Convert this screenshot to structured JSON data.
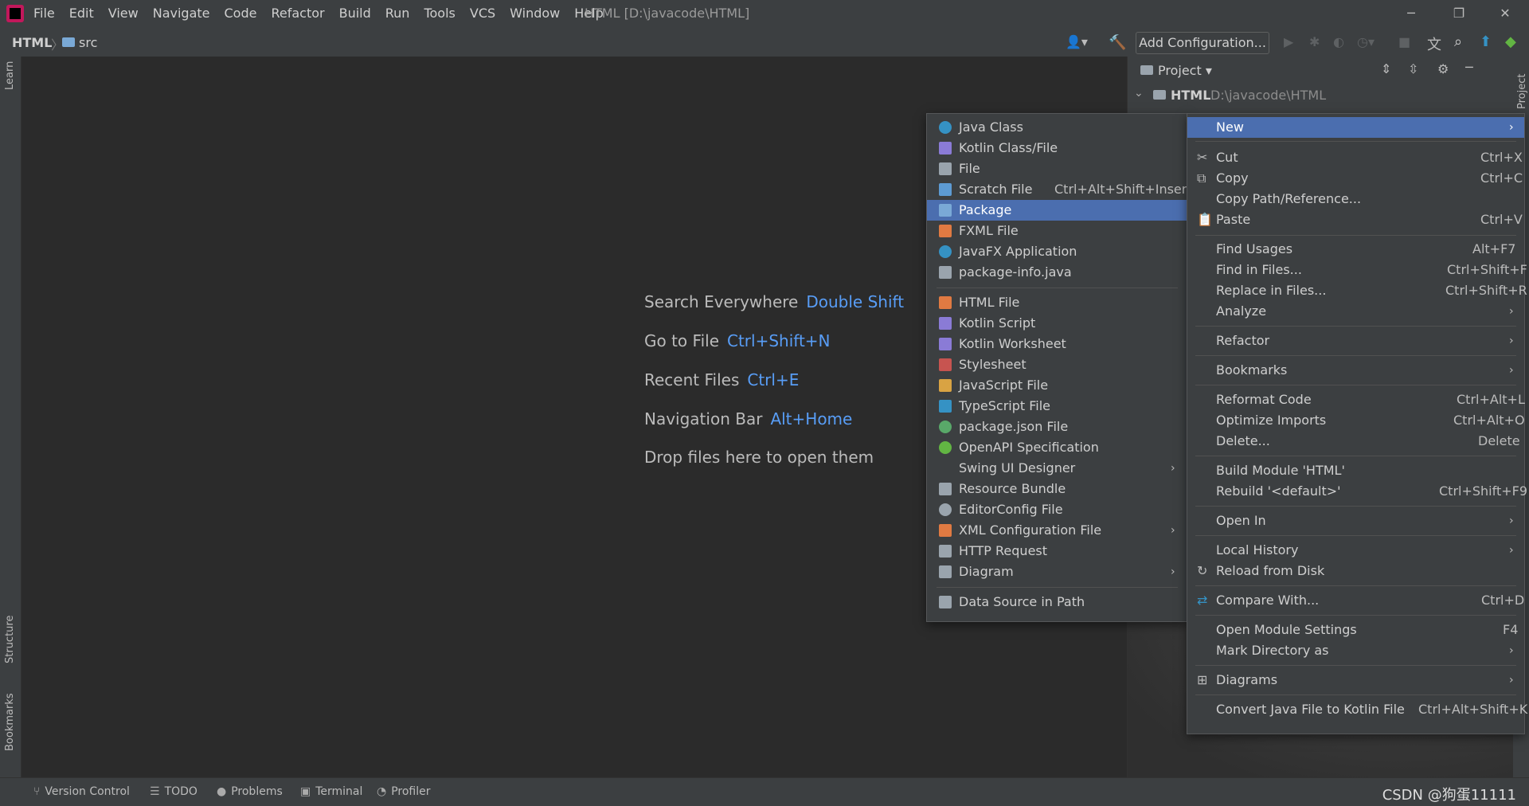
{
  "window": {
    "title": "HTML [D:\\javacode\\HTML]",
    "menus": [
      "File",
      "Edit",
      "View",
      "Navigate",
      "Code",
      "Refactor",
      "Build",
      "Run",
      "Tools",
      "VCS",
      "Window",
      "Help"
    ],
    "controls": {
      "minimize": "─",
      "restore": "❐",
      "close": "✕"
    }
  },
  "navbar": {
    "project": "HTML",
    "folder": "src",
    "add_configuration": "Add Configuration..."
  },
  "left_strip": {
    "learn": "Learn",
    "structure": "Structure",
    "bookmarks": "Bookmarks"
  },
  "right_strip": {
    "project": "Project"
  },
  "editor_hints": [
    {
      "label": "Search Everywhere",
      "key": "Double Shift"
    },
    {
      "label": "Go to File",
      "key": "Ctrl+Shift+N"
    },
    {
      "label": "Recent Files",
      "key": "Ctrl+E"
    },
    {
      "label": "Navigation Bar",
      "key": "Alt+Home"
    },
    {
      "label": "Drop files here to open them",
      "key": ""
    }
  ],
  "project_panel": {
    "title": "Project",
    "root_name": "HTML",
    "root_path": "D:\\javacode\\HTML"
  },
  "context_menu": {
    "items": [
      {
        "label": "New",
        "shortcut": "",
        "submenu": true,
        "selected": true
      },
      {
        "label": "Cut",
        "shortcut": "Ctrl+X",
        "icon": "cut-icon"
      },
      {
        "label": "Copy",
        "shortcut": "Ctrl+C",
        "icon": "copy-icon"
      },
      {
        "label": "Copy Path/Reference...",
        "shortcut": ""
      },
      {
        "label": "Paste",
        "shortcut": "Ctrl+V",
        "icon": "paste-icon"
      },
      {
        "label": "Find Usages",
        "shortcut": "Alt+F7"
      },
      {
        "label": "Find in Files...",
        "shortcut": "Ctrl+Shift+F"
      },
      {
        "label": "Replace in Files...",
        "shortcut": "Ctrl+Shift+R"
      },
      {
        "label": "Analyze",
        "shortcut": "",
        "submenu": true
      },
      {
        "label": "Refactor",
        "shortcut": "",
        "submenu": true
      },
      {
        "label": "Bookmarks",
        "shortcut": "",
        "submenu": true
      },
      {
        "label": "Reformat Code",
        "shortcut": "Ctrl+Alt+L"
      },
      {
        "label": "Optimize Imports",
        "shortcut": "Ctrl+Alt+O"
      },
      {
        "label": "Delete...",
        "shortcut": "Delete"
      },
      {
        "label": "Build Module 'HTML'",
        "shortcut": ""
      },
      {
        "label": "Rebuild '<default>'",
        "shortcut": "Ctrl+Shift+F9"
      },
      {
        "label": "Open In",
        "shortcut": "",
        "submenu": true
      },
      {
        "label": "Local History",
        "shortcut": "",
        "submenu": true
      },
      {
        "label": "Reload from Disk",
        "shortcut": "",
        "icon": "reload-icon"
      },
      {
        "label": "Compare With...",
        "shortcut": "Ctrl+D",
        "icon": "compare-icon"
      },
      {
        "label": "Open Module Settings",
        "shortcut": "F4"
      },
      {
        "label": "Mark Directory as",
        "shortcut": "",
        "submenu": true
      },
      {
        "label": "Diagrams",
        "shortcut": "",
        "submenu": true,
        "icon": "diagrams-icon"
      },
      {
        "label": "Convert Java File to Kotlin File",
        "shortcut": "Ctrl+Alt+Shift+K"
      }
    ]
  },
  "new_submenu": {
    "items": [
      {
        "label": "Java Class",
        "shortcut": "",
        "icon": "java-class-icon",
        "color": "#3592c4"
      },
      {
        "label": "Kotlin Class/File",
        "shortcut": "",
        "icon": "kotlin-file-icon",
        "color": "#8a7bd6"
      },
      {
        "label": "File",
        "shortcut": "",
        "icon": "file-icon",
        "color": "#9aa4ad"
      },
      {
        "label": "Scratch File",
        "shortcut": "Ctrl+Alt+Shift+Insert",
        "icon": "scratch-file-icon",
        "color": "#5d9bd3"
      },
      {
        "label": "Package",
        "shortcut": "",
        "icon": "package-icon",
        "color": "#7aa9d6",
        "selected": true
      },
      {
        "label": "FXML File",
        "shortcut": "",
        "icon": "fxml-file-icon",
        "color": "#e07a42"
      },
      {
        "label": "JavaFX Application",
        "shortcut": "",
        "icon": "javafx-icon",
        "color": "#3592c4"
      },
      {
        "label": "package-info.java",
        "shortcut": "",
        "icon": "package-info-icon",
        "color": "#9aa4ad"
      },
      {
        "label": "HTML File",
        "shortcut": "",
        "icon": "html-file-icon",
        "color": "#e07a42"
      },
      {
        "label": "Kotlin Script",
        "shortcut": "",
        "icon": "kotlin-script-icon",
        "color": "#8a7bd6"
      },
      {
        "label": "Kotlin Worksheet",
        "shortcut": "",
        "icon": "kotlin-worksheet-icon",
        "color": "#8a7bd6"
      },
      {
        "label": "Stylesheet",
        "shortcut": "",
        "icon": "css-icon",
        "color": "#c75450"
      },
      {
        "label": "JavaScript File",
        "shortcut": "",
        "icon": "js-file-icon",
        "color": "#d9a343"
      },
      {
        "label": "TypeScript File",
        "shortcut": "",
        "icon": "ts-file-icon",
        "color": "#3592c4"
      },
      {
        "label": "package.json File",
        "shortcut": "",
        "icon": "npm-icon",
        "color": "#59a869"
      },
      {
        "label": "OpenAPI Specification",
        "shortcut": "",
        "icon": "openapi-icon",
        "color": "#62b543"
      },
      {
        "label": "Swing UI Designer",
        "shortcut": "",
        "submenu": true
      },
      {
        "label": "Resource Bundle",
        "shortcut": "",
        "icon": "resource-bundle-icon",
        "color": "#9aa4ad"
      },
      {
        "label": "EditorConfig File",
        "shortcut": "",
        "icon": "gear-icon",
        "color": "#9aa4ad"
      },
      {
        "label": "XML Configuration File",
        "shortcut": "",
        "submenu": true,
        "icon": "xml-file-icon",
        "color": "#e07a42"
      },
      {
        "label": "HTTP Request",
        "shortcut": "",
        "icon": "http-request-icon",
        "color": "#9aa4ad"
      },
      {
        "label": "Diagram",
        "shortcut": "",
        "submenu": true,
        "icon": "diagram-icon",
        "color": "#9aa4ad"
      },
      {
        "label": "Data Source in Path",
        "shortcut": "",
        "icon": "database-icon",
        "color": "#9aa4ad"
      }
    ]
  },
  "statusbar": {
    "items": [
      "Version Control",
      "TODO",
      "Problems",
      "Terminal",
      "Profiler"
    ],
    "watermark": "CSDN @狗蛋11111"
  },
  "colors": {
    "accent": "#4b6eaf",
    "link": "#589df6",
    "bg": "#2b2b2b",
    "panel": "#3c3f41"
  }
}
